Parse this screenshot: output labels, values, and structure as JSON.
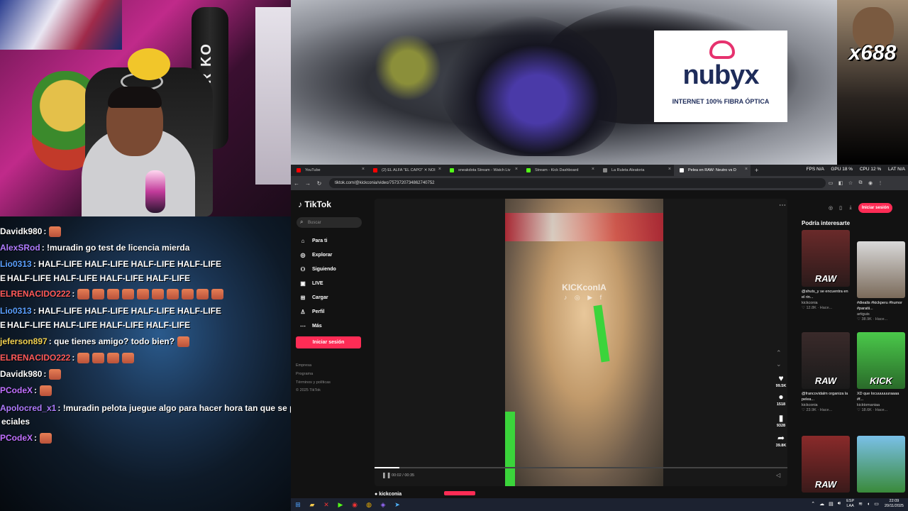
{
  "stream": {
    "webcam_bag_text": "MAJOR KO",
    "meme_counter": "x688"
  },
  "ad": {
    "brand": "nubyx",
    "tagline": "INTERNET 100% FIBRA ÓPTICA"
  },
  "chat": {
    "lines": [
      {
        "user": "Davidk980",
        "color": "#ffffff",
        "text": ":",
        "emotes": 1
      },
      {
        "user": "AlexSRod",
        "color": "#b07cff",
        "text": ": !muradin go test de licencia mierda",
        "emotes": 0
      },
      {
        "user": "Lio0313",
        "color": "#5aa0ff",
        "text": ": HALF-LIFE  HALF-LIFE  HALF-LIFE  HALF-LIFE",
        "emotes": 0
      },
      {
        "user": "E",
        "color": "#ffffff",
        "text": "HALF-LIFE  HALF-LIFE  HALF-LIFE  HALF-LIFE",
        "emotes": 0
      },
      {
        "user": "ELRENACIDO222",
        "color": "#ff5a5a",
        "text": ":",
        "emotes": 10
      },
      {
        "user": "Lio0313",
        "color": "#5aa0ff",
        "text": ": HALF-LIFE  HALF-LIFE  HALF-LIFE  HALF-LIFE",
        "emotes": 0
      },
      {
        "user": "E",
        "color": "#ffffff",
        "text": "HALF-LIFE  HALF-LIFE  HALF-LIFE  HALF-LIFE",
        "emotes": 0
      },
      {
        "user": "jeferson897",
        "color": "#f0d050",
        "text": ": que tienes amigo? todo bien?",
        "emotes": 1
      },
      {
        "user": "ELRENACIDO222",
        "color": "#ff5a5a",
        "text": ":",
        "emotes": 4
      },
      {
        "user": "Davidk980",
        "color": "#ffffff",
        "text": ":",
        "emotes": 1
      },
      {
        "user": "PCodeX",
        "color": "#c070ff",
        "text": ":",
        "emotes": 1
      },
      {
        "user": "Apolocred_x1",
        "color": "#b07cff",
        "text": ": !muradin pelota juegue algo para hacer hora tan que se p",
        "emotes": 0
      },
      {
        "user": "",
        "color": "#ffffff",
        "text": "eciales",
        "emotes": 0
      },
      {
        "user": "PCodeX",
        "color": "#c070ff",
        "text": ":",
        "emotes": 1
      }
    ]
  },
  "browser": {
    "tabs": [
      {
        "label": "YouTube",
        "fav": "#ff0000"
      },
      {
        "label": "(2) EL ALFA \"EL CAPO\" ✕ NOI",
        "fav": "#ff0000"
      },
      {
        "label": "sneakdota Stream - Watch Liv",
        "fav": "#53fc18"
      },
      {
        "label": "Stream - Kick Dashboard",
        "fav": "#53fc18"
      },
      {
        "label": "La Ruleta Aleatoria",
        "fav": "#888888"
      },
      {
        "label": "Pelea en RAW: Neutro vs D",
        "fav": "#ffffff"
      }
    ],
    "new_tab": "+",
    "perf": {
      "fps": "FPS N/A",
      "gpu": "GPU 18 %",
      "cpu": "CPU 12 %",
      "lat": "LAT N/A"
    },
    "url": "tiktok.com/@kickconia/video/7573720734862740752"
  },
  "tiktok": {
    "logo": "TikTok",
    "search_placeholder": "Buscar",
    "nav": [
      {
        "label": "Para ti",
        "icon": "⌂"
      },
      {
        "label": "Explorar",
        "icon": "◎"
      },
      {
        "label": "Siguiendo",
        "icon": "⚇"
      },
      {
        "label": "LIVE",
        "icon": "▣"
      },
      {
        "label": "Cargar",
        "icon": "⊞"
      },
      {
        "label": "Perfil",
        "icon": "♙"
      },
      {
        "label": "Más",
        "icon": "⋯"
      }
    ],
    "login_label": "Iniciar sesión",
    "footer": [
      "Empresa",
      "Programa",
      "Términos y políticas",
      "© 2025 TikTok"
    ],
    "video": {
      "watermark": "KICKconIA",
      "watermark_icons": "♪ ◎ ▶ f",
      "timecode": "00:02 / 00:35",
      "progress": 0.06,
      "author": "kickconia"
    },
    "actions": [
      {
        "icon": "♥",
        "count": "99.5K"
      },
      {
        "icon": "●",
        "count": "1518"
      },
      {
        "icon": "▮",
        "count": "9328"
      },
      {
        "icon": "➦",
        "count": "39.8K"
      }
    ],
    "right_login": "Iniciar sesión",
    "suggestions_title": "Podría interesarte",
    "suggestions": [
      {
        "overlay": "RAW",
        "caption": "@shuts_y se encuentra en el rin...",
        "author": "kickconia",
        "meta": "♡ 12.8K · Hace...",
        "bg": "linear-gradient(#6a2a2a,#2a1a1a)"
      },
      {
        "overlay": "",
        "caption": "#diealis #kickperu #humor #paratii...",
        "author": "artiguis",
        "meta": "♡ 38.9K · Hace...",
        "bg": "linear-gradient(#d9d9d9,#7a6a5a)"
      },
      {
        "overlay": "RAW",
        "caption": "@francovidalm organiza la pelea...",
        "author": "kickconia",
        "meta": "♡ 23.9K · Hace...",
        "bg": "linear-gradient(#3a2a2a,#1a1a1a)"
      },
      {
        "overlay": "KICK",
        "caption": "XD que locuuuuuuraaaa #f...",
        "author": "kicktomaniaa",
        "meta": "♡ 18.6K · Hace...",
        "bg": "linear-gradient(#4ac94a,#2a6a2a)"
      },
      {
        "overlay": "RAW",
        "caption": "",
        "author": "",
        "meta": "",
        "bg": "linear-gradient(#8a2a2a,#3a1a1a)"
      },
      {
        "overlay": "",
        "caption": "",
        "author": "",
        "meta": "",
        "bg": "linear-gradient(#7ac0e8,#3a8a3a)"
      }
    ]
  },
  "taskbar": {
    "lang": "ESP\nLAA",
    "time": "22:09",
    "date": "20/11/2025"
  }
}
